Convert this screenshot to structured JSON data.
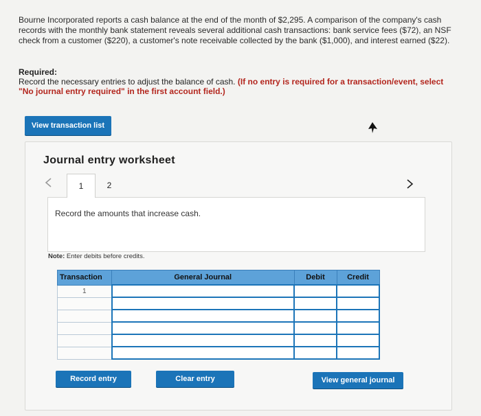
{
  "problem": {
    "text": "Bourne Incorporated reports a cash balance at the end of the month of $2,295. A comparison of the company's cash records with the monthly bank statement reveals several additional cash transactions: bank service fees ($72), an NSF check from a customer ($220), a customer's note receivable collected by the bank ($1,000), and interest earned ($22)."
  },
  "required": {
    "heading": "Required:",
    "instruction": "Record the necessary entries to adjust the balance of cash.",
    "red_note": "(If no entry is required for a transaction/event, select \"No journal entry required\" in the first account field.)"
  },
  "buttons": {
    "view_transaction_list": "View transaction list",
    "record_entry": "Record entry",
    "clear_entry": "Clear entry",
    "view_general_journal": "View general journal"
  },
  "worksheet": {
    "title": "Journal entry worksheet",
    "tabs": [
      "1",
      "2"
    ],
    "active_tab": "1",
    "description": "Record the amounts that increase cash.",
    "note_label": "Note:",
    "note_text": "Enter debits before credits.",
    "columns": [
      "Transaction",
      "General Journal",
      "Debit",
      "Credit"
    ],
    "rows": [
      {
        "transaction": "1"
      },
      {
        "transaction": ""
      },
      {
        "transaction": ""
      },
      {
        "transaction": ""
      },
      {
        "transaction": ""
      },
      {
        "transaction": ""
      }
    ]
  },
  "colors": {
    "button_blue": "#1b74b8",
    "header_blue": "#5da2d9",
    "red_instruction": "#b3261e"
  }
}
